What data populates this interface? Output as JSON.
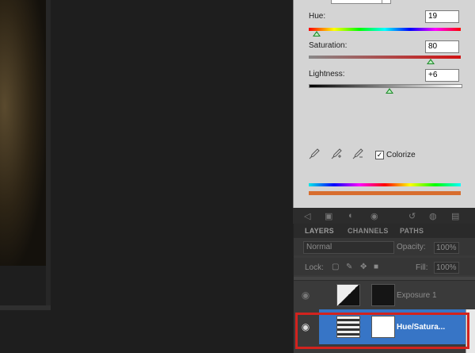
{
  "adjustments": {
    "hue": {
      "label": "Hue:",
      "value": "19",
      "position": 0.05
    },
    "saturation": {
      "label": "Saturation:",
      "value": "80",
      "position": 0.8
    },
    "lightness": {
      "label": "Lightness:",
      "value": "+6",
      "position": 0.53
    },
    "colorize": {
      "label": "Colorize",
      "checked": true,
      "mark": "✓"
    }
  },
  "layers_panel": {
    "tabs": [
      "LAYERS",
      "CHANNELS",
      "PATHS"
    ],
    "blend_mode": "Normal",
    "opacity_label": "Opacity:",
    "opacity_value": "100%",
    "lock_label": "Lock:",
    "fill_label": "Fill:",
    "fill_value": "100%",
    "layers": [
      {
        "name": "Exposure 1",
        "selected": false
      },
      {
        "name": "Hue/Satura...",
        "selected": true
      }
    ]
  },
  "colors": {
    "selection": "#3775c6",
    "highlight_border": "#d2231e",
    "panel_bg": "#d4d4d4",
    "layers_bg": "#3a3a3a"
  }
}
